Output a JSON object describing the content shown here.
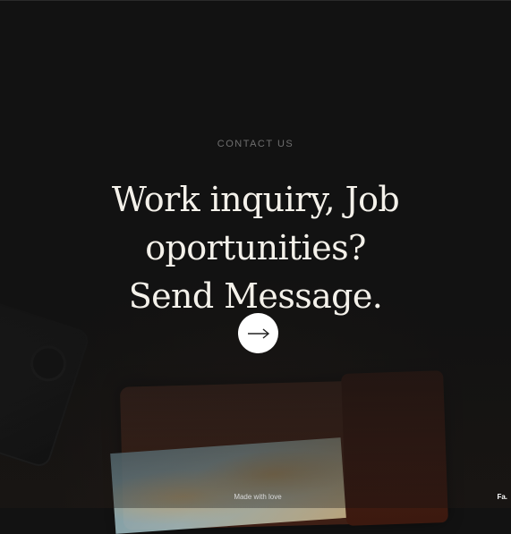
{
  "contact": {
    "eyebrow": "CONTACT US",
    "headline_line1": "Work inquiry, Job oportunities?",
    "headline_line2": "Send Message.",
    "cta_icon": "arrow-right-icon"
  },
  "footer": {
    "note": "Made with love",
    "brand": "Fa."
  }
}
